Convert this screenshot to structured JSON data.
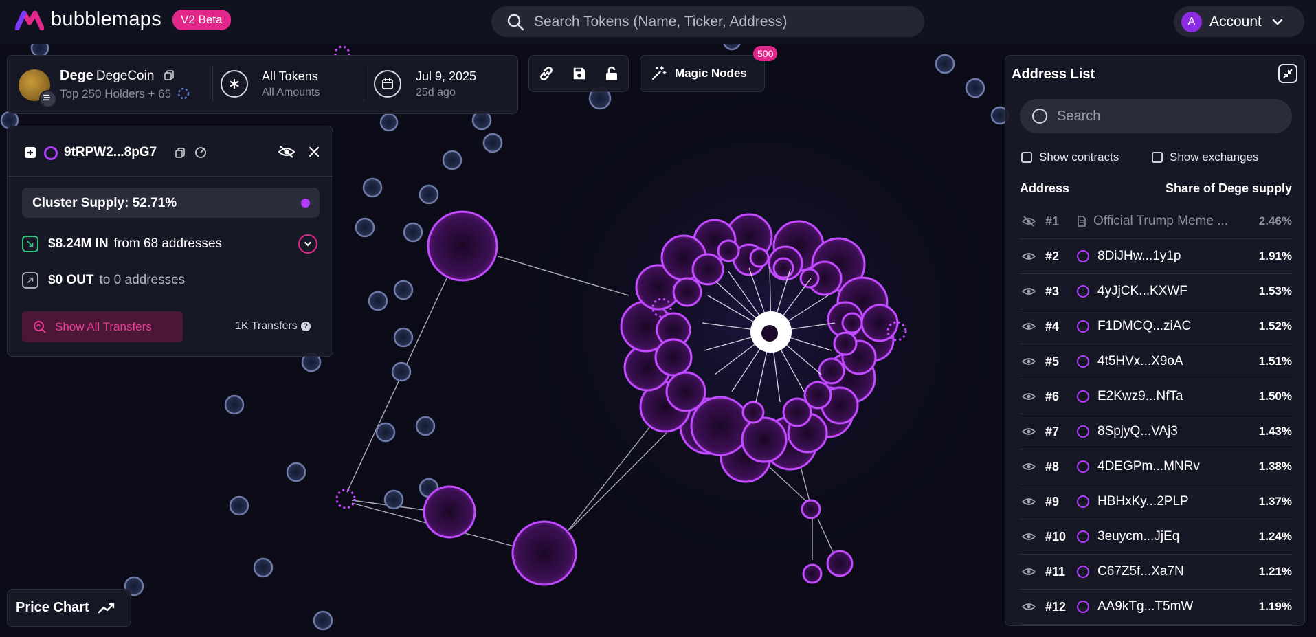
{
  "app": {
    "brand": "bubblemaps",
    "version_badge": "V2 Beta",
    "search_placeholder": "Search Tokens (Name, Ticker, Address)",
    "account_initial": "A",
    "account_label": "Account"
  },
  "token": {
    "symbol": "Dege",
    "name": "DegeCoin",
    "holders": "Top 250 Holders + 65",
    "filter_title": "All Tokens",
    "filter_sub": "All Amounts",
    "date": "Jul 9, 2025",
    "date_ago": "25d ago"
  },
  "magic_nodes": {
    "label": "Magic Nodes",
    "badge": "500"
  },
  "cluster": {
    "address": "9tRPW2...8pG7",
    "supply": "Cluster Supply: 52.71%",
    "in_amount": "$8.24M IN",
    "in_from": "from 68 addresses",
    "out_amount": "$0 OUT",
    "out_to": "to 0 addresses",
    "show_transfers": "Show All Transfers",
    "transfer_count": "1K Transfers",
    "help": "?"
  },
  "price_chart": {
    "label": "Price Chart"
  },
  "address_list": {
    "title": "Address List",
    "search_placeholder": "Search",
    "show_contracts": "Show contracts",
    "show_exchanges": "Show exchanges",
    "col_address": "Address",
    "col_share": "Share of Dege supply",
    "rows": [
      {
        "rank": "#1",
        "name": "Official Trump Meme ...",
        "pct": "2.46%",
        "hidden": true
      },
      {
        "rank": "#2",
        "name": "8DiJHw...1y1p",
        "pct": "1.91%"
      },
      {
        "rank": "#3",
        "name": "4yJjCK...KXWF",
        "pct": "1.53%"
      },
      {
        "rank": "#4",
        "name": "F1DMCQ...ziAC",
        "pct": "1.52%"
      },
      {
        "rank": "#5",
        "name": "4t5HVx...X9oA",
        "pct": "1.51%"
      },
      {
        "rank": "#6",
        "name": "E2Kwz9...NfTa",
        "pct": "1.50%"
      },
      {
        "rank": "#7",
        "name": "8SpjyQ...VAj3",
        "pct": "1.43%"
      },
      {
        "rank": "#8",
        "name": "4DEGPm...MNRv",
        "pct": "1.38%"
      },
      {
        "rank": "#9",
        "name": "HBHxKy...2PLP",
        "pct": "1.37%"
      },
      {
        "rank": "#10",
        "name": "3euycm...JjEq",
        "pct": "1.24%"
      },
      {
        "rank": "#11",
        "name": "C67Z5f...Xa7N",
        "pct": "1.21%"
      },
      {
        "rank": "#12",
        "name": "AA9kTg...T5mW",
        "pct": "1.19%"
      }
    ]
  },
  "colors": {
    "accent_pink": "#e2268a",
    "bubble_purple": "#b33cff",
    "background": "#0b0c18"
  }
}
